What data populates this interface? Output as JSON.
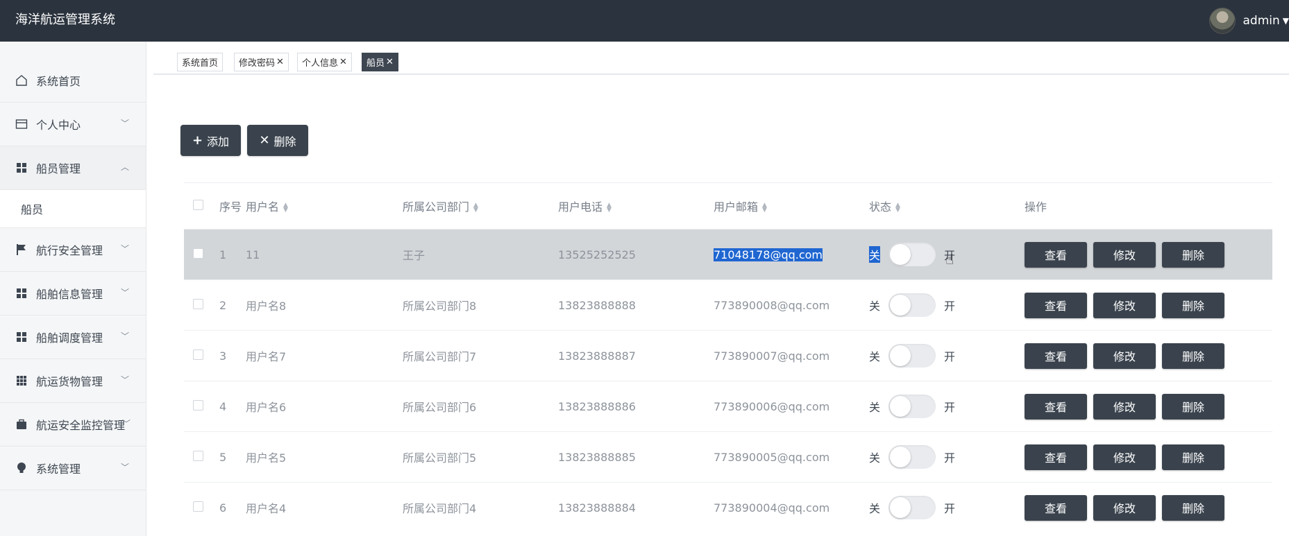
{
  "app": {
    "title": "海洋航运管理系统",
    "user": "admin"
  },
  "sidebar": {
    "items": [
      {
        "label": "系统首页",
        "icon": "home-icon"
      },
      {
        "label": "个人中心",
        "icon": "card-icon"
      },
      {
        "label": "船员管理",
        "icon": "grid-icon",
        "expanded": true
      },
      {
        "label": "航行安全管理",
        "icon": "flag-icon"
      },
      {
        "label": "船舶信息管理",
        "icon": "grid-icon"
      },
      {
        "label": "船舶调度管理",
        "icon": "grid-icon"
      },
      {
        "label": "航运货物管理",
        "icon": "apps-icon"
      },
      {
        "label": "航运安全监控管理",
        "icon": "briefcase-icon"
      },
      {
        "label": "系统管理",
        "icon": "bulb-icon"
      }
    ],
    "sub_item": "船员"
  },
  "tabs": [
    {
      "label": "系统首页",
      "closable": false
    },
    {
      "label": "修改密码",
      "closable": true
    },
    {
      "label": "个人信息",
      "closable": true
    },
    {
      "label": "船员",
      "closable": true,
      "active": true
    }
  ],
  "toolbar": {
    "add_label": "添加",
    "delete_label": "删除"
  },
  "table": {
    "headers": {
      "no": "序号",
      "username": "用户名",
      "dept": "所属公司部门",
      "phone": "用户电话",
      "email": "用户邮箱",
      "state": "状态",
      "ops": "操作"
    },
    "switch_off": "关",
    "switch_on": "开",
    "op_view": "查看",
    "op_edit": "修改",
    "op_delete": "删除",
    "rows": [
      {
        "no": "1",
        "username": "11",
        "dept": "王子",
        "phone": "13525252525",
        "email": "71048178@qq.com"
      },
      {
        "no": "2",
        "username": "用户名8",
        "dept": "所属公司部门8",
        "phone": "13823888888",
        "email": "773890008@qq.com"
      },
      {
        "no": "3",
        "username": "用户名7",
        "dept": "所属公司部门7",
        "phone": "13823888887",
        "email": "773890007@qq.com"
      },
      {
        "no": "4",
        "username": "用户名6",
        "dept": "所属公司部门6",
        "phone": "13823888886",
        "email": "773890006@qq.com"
      },
      {
        "no": "5",
        "username": "用户名5",
        "dept": "所属公司部门5",
        "phone": "13823888885",
        "email": "773890005@qq.com"
      },
      {
        "no": "6",
        "username": "用户名4",
        "dept": "所属公司部门4",
        "phone": "13823888884",
        "email": "773890004@qq.com"
      }
    ]
  },
  "colors": {
    "topbar": "#2b333e",
    "button": "#3a434d",
    "selection": "#1f66d1",
    "row_highlight": "#d3d6d9"
  }
}
